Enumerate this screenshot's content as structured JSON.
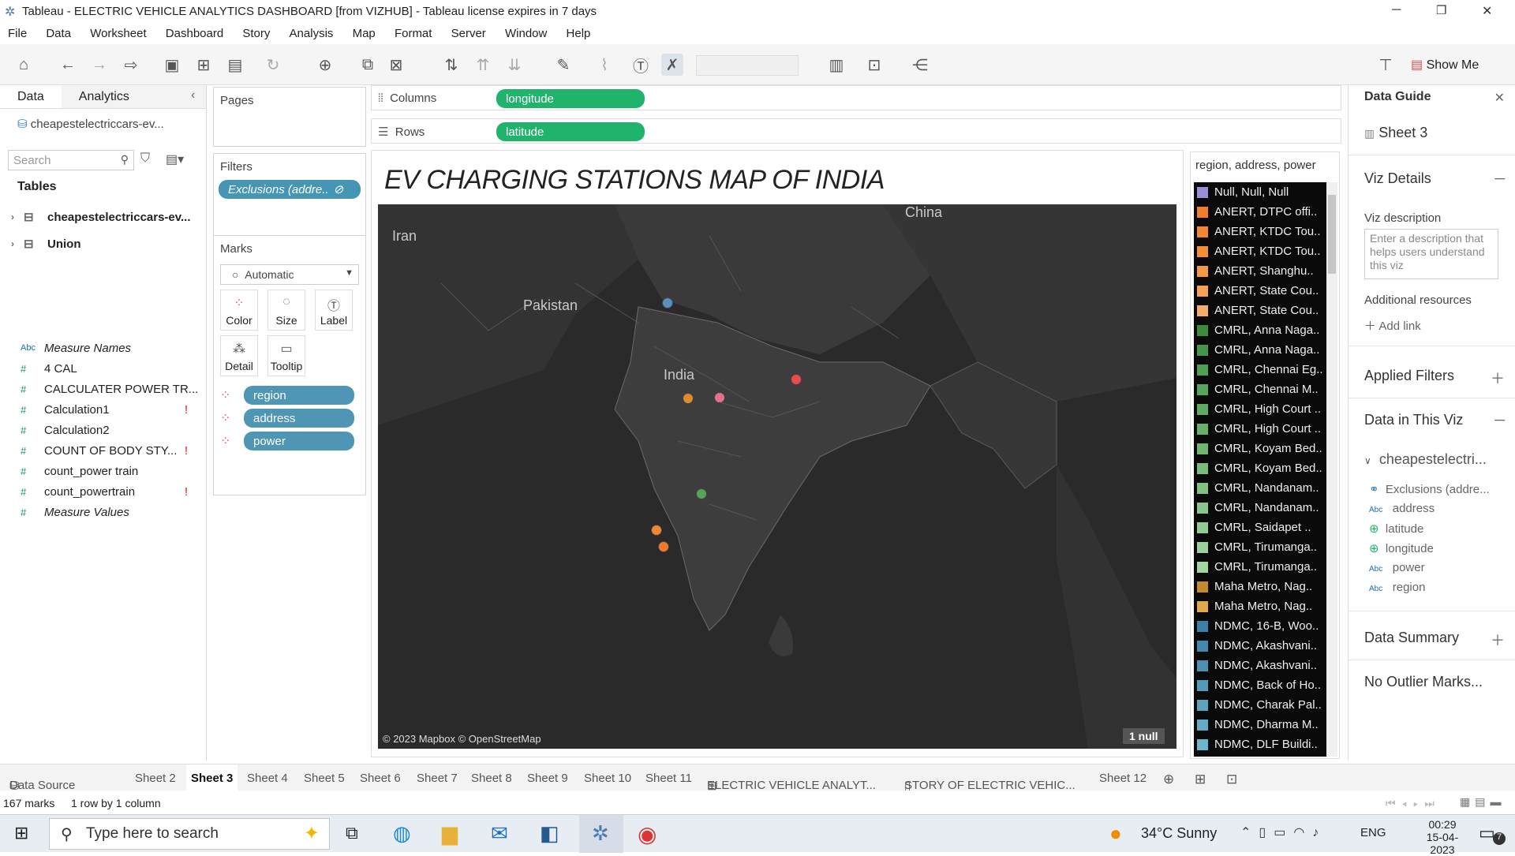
{
  "window": {
    "title": "Tableau - ELECTRIC VEHICLE ANALYTICS DASHBOARD [from VIZHUB] - Tableau license expires in 7 days"
  },
  "menu": [
    "File",
    "Data",
    "Worksheet",
    "Dashboard",
    "Story",
    "Analysis",
    "Map",
    "Format",
    "Server",
    "Window",
    "Help"
  ],
  "toolbar": {
    "show_me": "Show Me"
  },
  "left": {
    "tabs": [
      "Data",
      "Analytics"
    ],
    "datasource": "cheapestelectriccars-ev...",
    "search_placeholder": "Search",
    "tables_heading": "Tables",
    "tables": [
      "cheapestelectriccars-ev...",
      "Union"
    ],
    "fields": [
      {
        "icon": "Abc",
        "name": "Measure Names",
        "italic": true,
        "warn": false
      },
      {
        "icon": "#",
        "name": "4 CAL",
        "italic": false,
        "warn": false
      },
      {
        "icon": "#",
        "name": "CALCULATER POWER TR...",
        "italic": false,
        "warn": false
      },
      {
        "icon": "#",
        "name": "Calculation1",
        "italic": false,
        "warn": true
      },
      {
        "icon": "#",
        "name": "Calculation2",
        "italic": false,
        "warn": false
      },
      {
        "icon": "#",
        "name": "COUNT OF BODY STY...",
        "italic": false,
        "warn": true
      },
      {
        "icon": "#",
        "name": "count_power train",
        "italic": false,
        "warn": false
      },
      {
        "icon": "#",
        "name": "count_powertrain",
        "italic": false,
        "warn": true
      },
      {
        "icon": "#",
        "name": "Measure Values",
        "italic": true,
        "warn": false
      }
    ]
  },
  "cards": {
    "pages": "Pages",
    "filters": "Filters",
    "filter_pill": "Exclusions (addre..",
    "marks": "Marks",
    "mark_type": "Automatic",
    "mark_buttons": [
      "Color",
      "Size",
      "Label",
      "Detail",
      "Tooltip"
    ],
    "mark_pills": [
      "region",
      "address",
      "power"
    ]
  },
  "shelves": {
    "columns_label": "Columns",
    "columns_pill": "longitude",
    "rows_label": "Rows",
    "rows_pill": "latitude"
  },
  "view": {
    "title": "EV CHARGING STATIONS MAP OF INDIA",
    "labels": [
      "Iran",
      "China",
      "Pakistan",
      "India"
    ],
    "attribution": "© 2023 Mapbox © OpenStreetMap",
    "null_badge": "1 null",
    "points": [
      {
        "name": "north-india",
        "color": "#5b8fc0"
      },
      {
        "name": "central-india-a",
        "color": "#e08a2e"
      },
      {
        "name": "central-india-b",
        "color": "#e76f8a"
      },
      {
        "name": "kolkata",
        "color": "#ef4a4a"
      },
      {
        "name": "chennai",
        "color": "#57a457"
      },
      {
        "name": "kerala-a",
        "color": "#f4862f"
      },
      {
        "name": "kerala-b",
        "color": "#f47a2b"
      }
    ]
  },
  "legend": {
    "title": "region, address, power",
    "items": [
      {
        "label": "Null, Null, Null",
        "color": "#9a8fd6"
      },
      {
        "label": "ANERT, DTPC offi..",
        "color": "#f07f2c"
      },
      {
        "label": "ANERT, KTDC Tou..",
        "color": "#f3872f"
      },
      {
        "label": "ANERT, KTDC Tou..",
        "color": "#f58f33"
      },
      {
        "label": "ANERT, Shanghu..",
        "color": "#f59843"
      },
      {
        "label": "ANERT, State Cou..",
        "color": "#f6a157"
      },
      {
        "label": "ANERT, State Cou..",
        "color": "#f7ab69"
      },
      {
        "label": "CMRL, Anna Naga..",
        "color": "#3d8b3d"
      },
      {
        "label": "CMRL, Anna Naga..",
        "color": "#45954a"
      },
      {
        "label": "CMRL, Chennai Eg..",
        "color": "#4e9e54"
      },
      {
        "label": "CMRL, Chennai M..",
        "color": "#57a55c"
      },
      {
        "label": "CMRL, High Court ..",
        "color": "#5fab63"
      },
      {
        "label": "CMRL, High Court ..",
        "color": "#68b16b"
      },
      {
        "label": "CMRL, Koyam Bed..",
        "color": "#70b673"
      },
      {
        "label": "CMRL, Koyam Bed..",
        "color": "#79bc7b"
      },
      {
        "label": "CMRL, Nandanam..",
        "color": "#81c183"
      },
      {
        "label": "CMRL, Nandanam..",
        "color": "#8ac68b"
      },
      {
        "label": "CMRL, Saidapet ..",
        "color": "#92cb93"
      },
      {
        "label": "CMRL, Tirumanga..",
        "color": "#9bd09a"
      },
      {
        "label": "CMRL, Tirumanga..",
        "color": "#a3d5a2"
      },
      {
        "label": "Maha Metro, Nag..",
        "color": "#c58a2e"
      },
      {
        "label": "Maha Metro, Nag..",
        "color": "#e2a84c"
      },
      {
        "label": "NDMC, 16-B, Woo..",
        "color": "#3c7fa6"
      },
      {
        "label": "NDMC, Akashvani..",
        "color": "#4488ac"
      },
      {
        "label": "NDMC, Akashvani..",
        "color": "#4c91b2"
      },
      {
        "label": "NDMC, Back of Ho..",
        "color": "#549ab8"
      },
      {
        "label": "NDMC, Charak Pal..",
        "color": "#5ca3be"
      },
      {
        "label": "NDMC, Dharma M..",
        "color": "#64acc4"
      },
      {
        "label": "NDMC, DLF Buildi..",
        "color": "#6cb5ca"
      }
    ]
  },
  "guide": {
    "title": "Data Guide",
    "sheet": "Sheet 3",
    "viz_details": "Viz Details",
    "viz_desc_label": "Viz description",
    "viz_desc_placeholder": "Enter a description that helps users understand this viz",
    "additional": "Additional resources",
    "add_link": "Add link",
    "applied_filters": "Applied Filters",
    "data_in_viz": "Data in This Viz",
    "source": "cheapestelectri...",
    "items": [
      {
        "icon": "link",
        "name": "Exclusions (addre..."
      },
      {
        "icon": "Abc",
        "name": "address"
      },
      {
        "icon": "globe",
        "name": "latitude"
      },
      {
        "icon": "globe",
        "name": "longitude"
      },
      {
        "icon": "Abc",
        "name": "power"
      },
      {
        "icon": "Abc",
        "name": "region"
      }
    ],
    "data_summary": "Data Summary",
    "no_outlier": "No Outlier Marks..."
  },
  "sheettabs": [
    "Data Source",
    "Sheet 2",
    "Sheet 3",
    "Sheet 4",
    "Sheet 5",
    "Sheet 6",
    "Sheet 7",
    "Sheet 8",
    "Sheet 9",
    "Sheet 10",
    "Sheet 11",
    "ELECTRIC VEHICLE ANALYT...",
    "STORY OF ELECTRIC VEHIC...",
    "Sheet 12"
  ],
  "status": {
    "marks": "167 marks",
    "dims": "1 row by 1 column"
  },
  "taskbar": {
    "search": "Type here to search",
    "weather": "34°C  Sunny",
    "lang": "ENG",
    "time": "00:29",
    "date": "15-04-2023",
    "notif": "7"
  }
}
